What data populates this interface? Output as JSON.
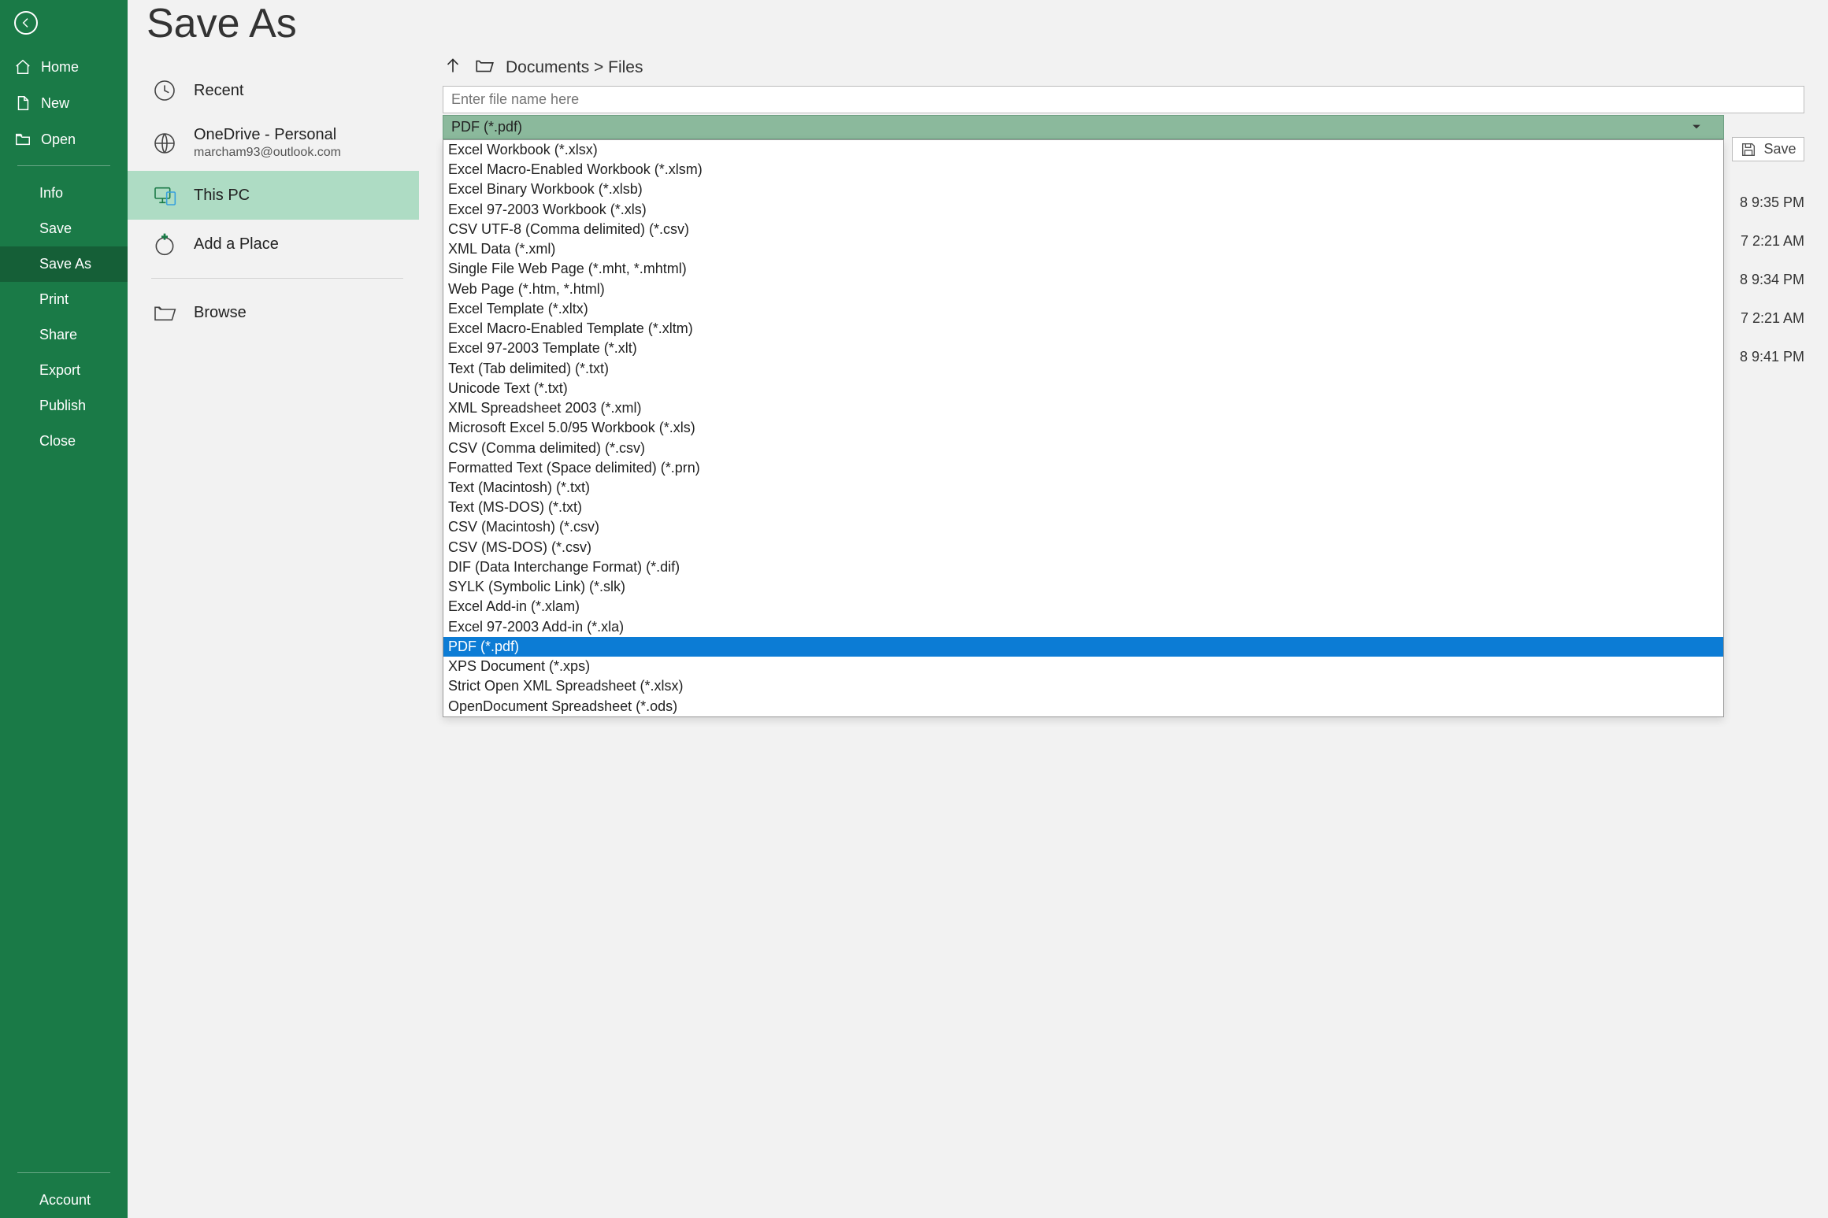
{
  "page_title": "Save As",
  "sidebar": {
    "home": "Home",
    "new": "New",
    "open": "Open",
    "info": "Info",
    "save": "Save",
    "save_as": "Save As",
    "print": "Print",
    "share": "Share",
    "export": "Export",
    "publish": "Publish",
    "close": "Close",
    "account": "Account"
  },
  "locations": {
    "recent": "Recent",
    "onedrive_title": "OneDrive - Personal",
    "onedrive_sub": "marcham93@outlook.com",
    "this_pc": "This PC",
    "add_place": "Add a Place",
    "browse": "Browse"
  },
  "breadcrumb": "Documents > Files",
  "filename_placeholder": "Enter file name here",
  "save_label": "Save",
  "filetype_selected": "PDF (*.pdf)",
  "filetype_options": [
    "Excel Workbook (*.xlsx)",
    "Excel Macro-Enabled Workbook (*.xlsm)",
    "Excel Binary Workbook (*.xlsb)",
    "Excel 97-2003 Workbook (*.xls)",
    "CSV UTF-8 (Comma delimited) (*.csv)",
    "XML Data (*.xml)",
    "Single File Web Page (*.mht, *.mhtml)",
    "Web Page (*.htm, *.html)",
    "Excel Template (*.xltx)",
    "Excel Macro-Enabled Template (*.xltm)",
    "Excel 97-2003 Template (*.xlt)",
    "Text (Tab delimited) (*.txt)",
    "Unicode Text (*.txt)",
    "XML Spreadsheet 2003 (*.xml)",
    "Microsoft Excel 5.0/95 Workbook (*.xls)",
    "CSV (Comma delimited) (*.csv)",
    "Formatted Text (Space delimited) (*.prn)",
    "Text (Macintosh) (*.txt)",
    "Text (MS-DOS) (*.txt)",
    "CSV (Macintosh) (*.csv)",
    "CSV (MS-DOS) (*.csv)",
    "DIF (Data Interchange Format) (*.dif)",
    "SYLK (Symbolic Link) (*.slk)",
    "Excel Add-in (*.xlam)",
    "Excel 97-2003 Add-in (*.xla)",
    "PDF (*.pdf)",
    "XPS Document (*.xps)",
    "Strict Open XML Spreadsheet (*.xlsx)",
    "OpenDocument Spreadsheet (*.ods)"
  ],
  "filetype_highlight_index": 25,
  "files": [
    {
      "date": "8 9:35 PM"
    },
    {
      "date": "7 2:21 AM"
    },
    {
      "date": "8 9:34 PM"
    },
    {
      "date": "7 2:21 AM"
    },
    {
      "date": "8 9:41 PM"
    }
  ]
}
